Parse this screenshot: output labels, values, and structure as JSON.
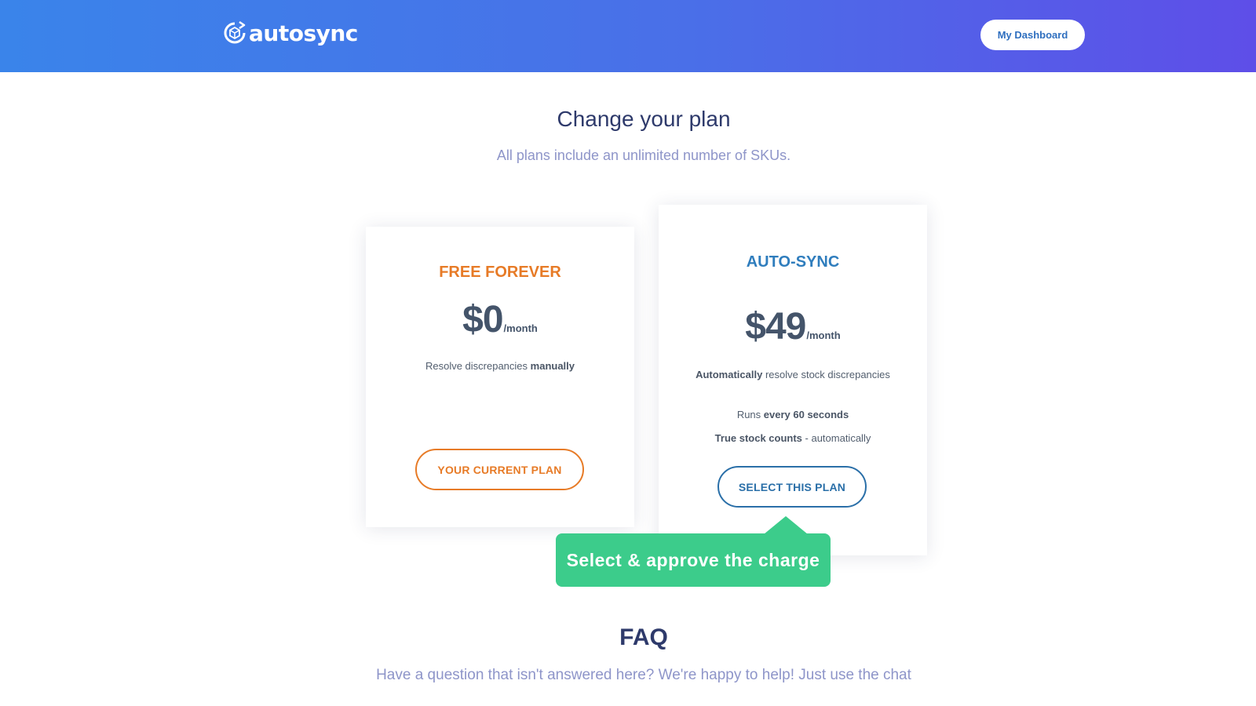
{
  "header": {
    "logo_text": "autosync",
    "dashboard_button": "My Dashboard"
  },
  "main": {
    "title": "Change your plan",
    "subtitle": "All plans include an unlimited number of SKUs."
  },
  "plans": [
    {
      "name": "FREE FOREVER",
      "price": "$0",
      "period": "/month",
      "features": [
        {
          "text": "Resolve discrepancies ",
          "bold": "manually"
        }
      ],
      "button": "YOUR CURRENT PLAN"
    },
    {
      "name": "AUTO-SYNC",
      "price": "$49",
      "period": "/month",
      "features": [
        {
          "bold": "Automatically",
          "text": " resolve stock discrepancies"
        },
        {
          "pre": "Runs ",
          "bold": "every 60 seconds"
        },
        {
          "bold": "True stock counts",
          "text": " - automatically"
        }
      ],
      "button": "SELECT THIS PLAN"
    }
  ],
  "tooltip": {
    "text": "Select & approve the charge"
  },
  "faq": {
    "title": "FAQ",
    "subtitle": "Have a question that isn't answered here? We're happy to help! Just use the chat"
  },
  "colors": {
    "header_gradient_start": "#3a84ea",
    "header_gradient_end": "#5e4ee8",
    "free_accent": "#e77b27",
    "auto_accent": "#2f7dbd",
    "tooltip_bg": "#3ccc8b"
  },
  "icons": {
    "logo": "sync-cube-icon"
  }
}
